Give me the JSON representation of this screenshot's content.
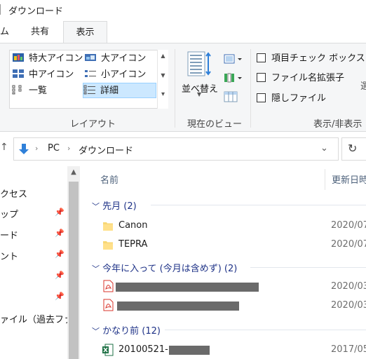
{
  "window": {
    "title": "ダウンロード"
  },
  "ribbon_tabs": [
    {
      "label": "ム"
    },
    {
      "label": "共有"
    },
    {
      "label": "表示"
    }
  ],
  "layout_group": {
    "items": [
      {
        "label": "特大アイコン",
        "icon": "extra-large-icons-icon"
      },
      {
        "label": "大アイコン",
        "icon": "large-icons-icon"
      },
      {
        "label": "中アイコン",
        "icon": "medium-icons-icon"
      },
      {
        "label": "小アイコン",
        "icon": "small-icons-icon"
      },
      {
        "label": "一覧",
        "icon": "list-view-icon"
      },
      {
        "label": "詳細",
        "icon": "details-view-icon",
        "selected": true
      }
    ],
    "label": "レイアウト"
  },
  "current_view_group": {
    "sort_label": "並べ替え",
    "label": "現在のビュー"
  },
  "show_hide_group": {
    "checkboxes": [
      {
        "label": "項目チェック ボックス",
        "checked": false
      },
      {
        "label": "ファイル名拡張子",
        "checked": false
      },
      {
        "label": "隠しファイル",
        "checked": false
      }
    ],
    "label": "表示/非表示",
    "partial_text": "選"
  },
  "address_bar": {
    "path": [
      "PC",
      "ダウンロード"
    ]
  },
  "nav_pane": {
    "items": [
      {
        "label": "クセス"
      },
      {
        "label": "ップ"
      },
      {
        "label": "ード"
      },
      {
        "label": "ント"
      },
      {
        "label": ""
      },
      {
        "label": ""
      },
      {
        "label": "ァイル（過去ファ"
      }
    ]
  },
  "file_list": {
    "columns": {
      "name": "名前",
      "modified": "更新日時"
    },
    "groups": [
      {
        "title": "先月 (2)",
        "rows": [
          {
            "type": "folder",
            "name": "Canon",
            "date": "2020/07"
          },
          {
            "type": "folder",
            "name": "TEPRA",
            "date": "2020/07"
          }
        ]
      },
      {
        "title": "今年に入って (今月は含めず) (2)",
        "rows": [
          {
            "type": "pdf",
            "name": "",
            "date": "2020/03"
          },
          {
            "type": "pdf",
            "name": "",
            "date": "2020/03"
          }
        ]
      },
      {
        "title": "かなり前 (12)",
        "rows": [
          {
            "type": "excel",
            "name": "20100521-",
            "date": "2017/05"
          }
        ]
      }
    ]
  },
  "colors": {
    "selection_bg": "#cce8ff",
    "group_header_text": "#1e3287",
    "column_header_text": "#4c607a",
    "folder_yellow": "#f8d775",
    "pdf_red": "#d9342b",
    "excel_green": "#1e7145",
    "address_arrow_blue": "#2f80d9"
  }
}
